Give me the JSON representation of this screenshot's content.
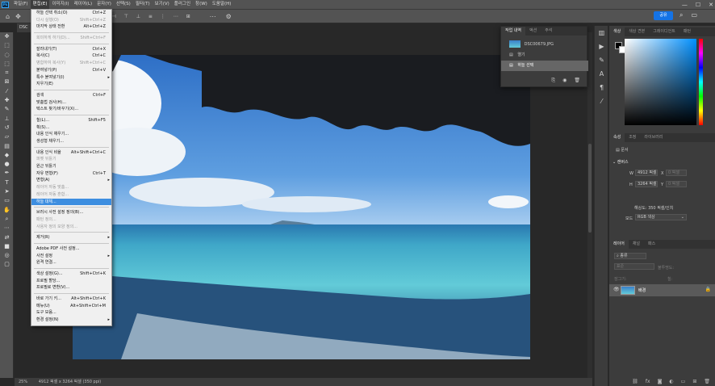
{
  "menubar": {
    "logo": "Ps",
    "items": [
      "파일(F)",
      "편집(E)",
      "이미지(I)",
      "레이어(L)",
      "문자(Y)",
      "선택(S)",
      "필터(T)",
      "보기(V)",
      "플러그인",
      "창(W)",
      "도움말(H)"
    ],
    "active_index": 1
  },
  "window_controls": {
    "minimize": "—",
    "maximize": "☐",
    "close": "✕"
  },
  "options_bar": {
    "icons": [
      "home-icon",
      "move-icon",
      "auto-select-icon",
      "align-icons",
      "more-icon",
      "gear-icon"
    ]
  },
  "share_button": "공유",
  "document_tab": "DSC",
  "edit_menu": [
    {
      "label": "하늘 선택 취소(O)",
      "shortcut": "Ctrl+Z"
    },
    {
      "label": "다시 실행(O)",
      "shortcut": "Shift+Ctrl+Z",
      "disabled": true
    },
    {
      "label": "마지막 상태 전환",
      "shortcut": "Alt+Ctrl+Z"
    },
    {
      "sep": true
    },
    {
      "label": "희미하게 하기(D)...",
      "shortcut": "Shift+Ctrl+F",
      "disabled": true
    },
    {
      "sep": true
    },
    {
      "label": "잘라내기(T)",
      "shortcut": "Ctrl+X"
    },
    {
      "label": "복사(C)",
      "shortcut": "Ctrl+C"
    },
    {
      "label": "병합하여 복사(Y)",
      "shortcut": "Shift+Ctrl+C",
      "disabled": true
    },
    {
      "label": "붙여넣기(P)",
      "shortcut": "Ctrl+V"
    },
    {
      "label": "특수 붙여넣기(I)",
      "submenu": true
    },
    {
      "label": "지우기(E)"
    },
    {
      "sep": true
    },
    {
      "label": "검색",
      "shortcut": "Ctrl+F"
    },
    {
      "label": "맞춤법 검사(H)..."
    },
    {
      "label": "텍스트 찾기/바꾸기(X)..."
    },
    {
      "sep": true
    },
    {
      "label": "칠(L)...",
      "shortcut": "Shift+F5"
    },
    {
      "label": "획(S)..."
    },
    {
      "label": "내용 인식 채우기..."
    },
    {
      "label": "생성형 채우기..."
    },
    {
      "sep": true
    },
    {
      "label": "내용 인식 비율",
      "shortcut": "Alt+Shift+Ctrl+C"
    },
    {
      "label": "퍼펫 뒤틀기",
      "disabled": true
    },
    {
      "label": "원근 뒤틀기"
    },
    {
      "label": "자유 변형(F)",
      "shortcut": "Ctrl+T"
    },
    {
      "label": "변형(A)",
      "submenu": true
    },
    {
      "label": "레이어 자동 맞춤...",
      "disabled": true
    },
    {
      "label": "레이어 자동 혼합...",
      "disabled": true
    },
    {
      "label": "하늘 대체...",
      "highlighted": true
    },
    {
      "sep": true
    },
    {
      "label": "브러시 사전 설정 정의(B)..."
    },
    {
      "label": "패턴 정의...",
      "disabled": true
    },
    {
      "label": "사용자 정의 모양 정의...",
      "disabled": true
    },
    {
      "sep": true
    },
    {
      "label": "제거(R)",
      "submenu": true
    },
    {
      "sep": true
    },
    {
      "label": "Adobe PDF 사전 설정..."
    },
    {
      "label": "사전 설정",
      "submenu": true
    },
    {
      "label": "원격 연결..."
    },
    {
      "sep": true
    },
    {
      "label": "색상 설정(G)...",
      "shortcut": "Shift+Ctrl+K"
    },
    {
      "label": "프로필 할당..."
    },
    {
      "label": "프로필로 변환(V)..."
    },
    {
      "sep": true
    },
    {
      "label": "바로 가기 키...",
      "shortcut": "Alt+Shift+Ctrl+K"
    },
    {
      "label": "메뉴(U)",
      "shortcut": "Alt+Shift+Ctrl+M"
    },
    {
      "label": "도구 모음..."
    },
    {
      "label": "환경 설정(N)",
      "submenu": true
    }
  ],
  "history_panel": {
    "tabs": [
      "작업 내역",
      "액션",
      "주석"
    ],
    "snapshot": "DSC00679.JPG",
    "states": [
      "열기",
      "하늘 선택"
    ],
    "active_state": 1
  },
  "color_panel": {
    "tabs": [
      "색상",
      "색상 견본",
      "그레이디언트",
      "패턴"
    ]
  },
  "properties_panel": {
    "tabs": [
      "속성",
      "조정",
      "라이브러리"
    ],
    "type_label": "문서",
    "section": "캔버스",
    "w_label": "W",
    "w_value": "4912 픽셀",
    "h_label": "H",
    "h_value": "3264 픽셀",
    "x_label": "X",
    "x_value": "0 픽셀",
    "y_label": "Y",
    "y_value": "0 픽셀",
    "resolution": "해상도: 350 픽셀/인치",
    "mode_label": "모드",
    "mode_value": "RGB 색상"
  },
  "layers_panel": {
    "tabs": [
      "레이어",
      "채널",
      "패스"
    ],
    "search": "종류",
    "blend": "표준",
    "opacity": "불투명도:",
    "lock": "잠그기:",
    "fill": "칠:",
    "layer_name": "배경"
  },
  "status_bar": {
    "zoom": "25%",
    "doc_info": "4912 픽셀 x 3264 픽셀 (350 ppi)"
  }
}
